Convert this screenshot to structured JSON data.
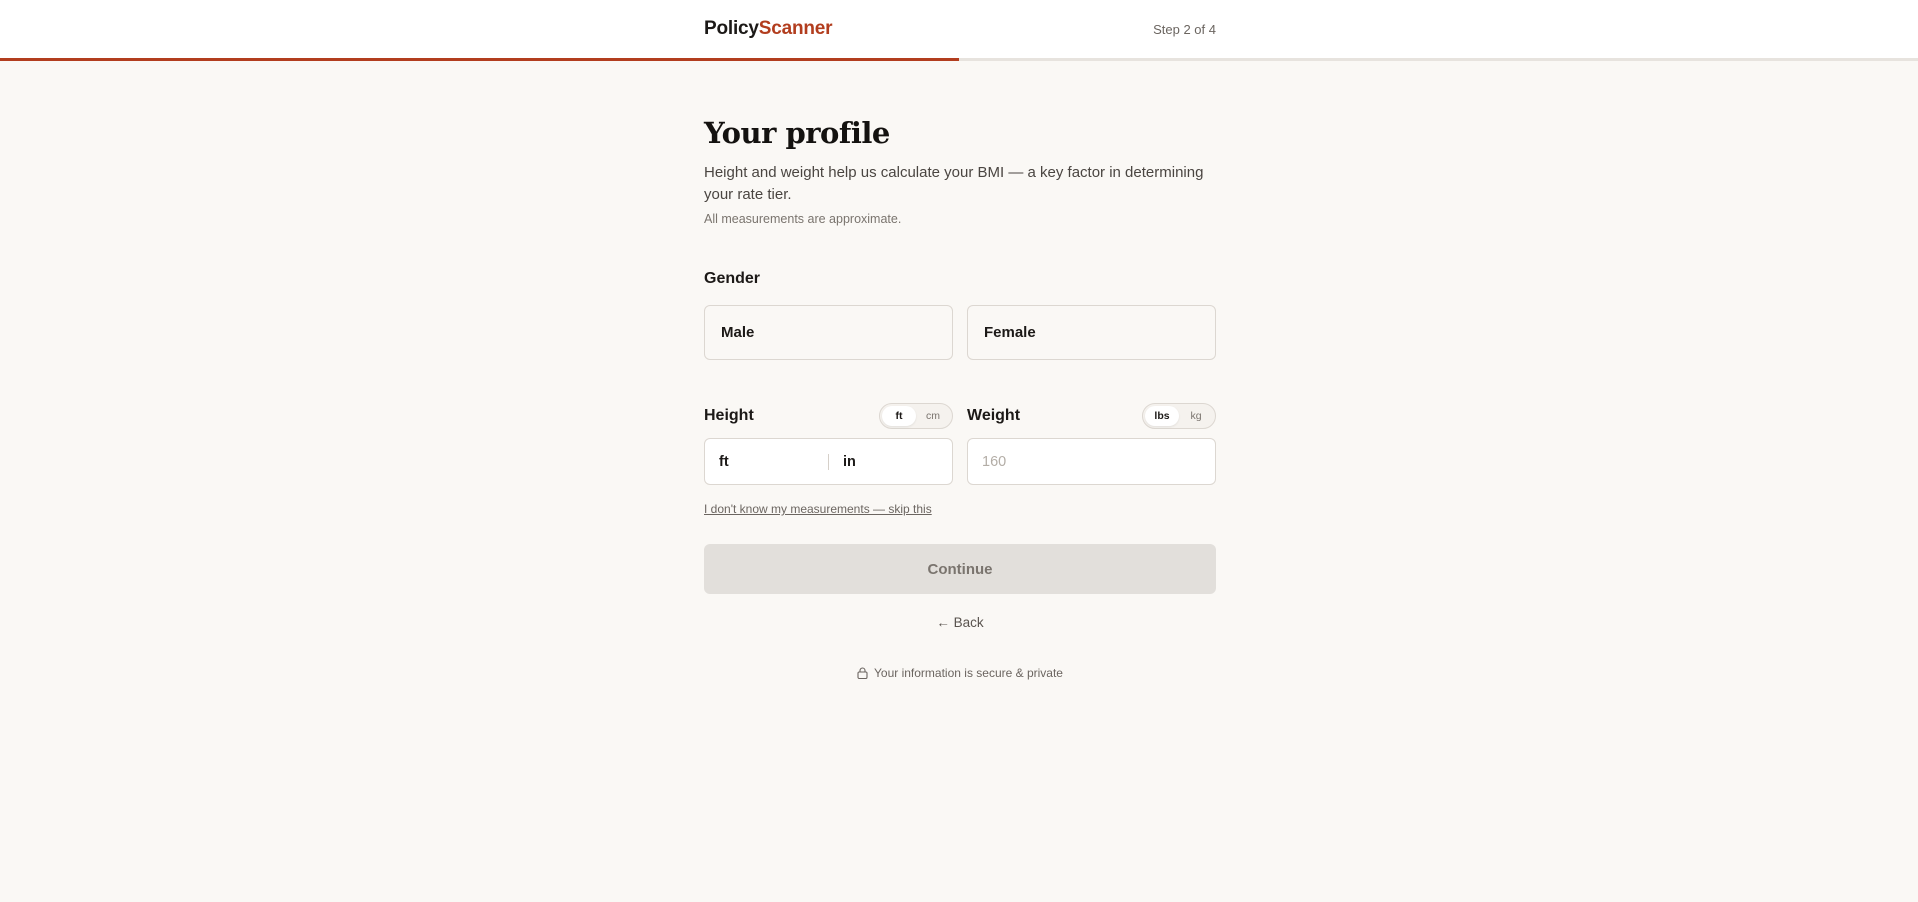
{
  "header": {
    "brand_a": "Policy",
    "brand_b": "Scanner",
    "step_text": "Step 2 of 4",
    "progress_fraction": 0.5,
    "accent_color": "#b23d1e"
  },
  "page": {
    "title": "Your profile",
    "subtitle": "Height and weight help us calculate your BMI — a key factor in determining your rate tier.",
    "note": "All measurements are approximate."
  },
  "gender": {
    "label": "Gender",
    "options": [
      "Male",
      "Female"
    ]
  },
  "height": {
    "label": "Height",
    "units": [
      "ft",
      "cm"
    ],
    "active_unit": "ft",
    "ft_label": "ft",
    "in_label": "in"
  },
  "weight": {
    "label": "Weight",
    "units": [
      "lbs",
      "kg"
    ],
    "active_unit": "lbs",
    "placeholder": "160",
    "value": ""
  },
  "actions": {
    "skip_text": "I don't know my measurements — skip this",
    "continue_label": "Continue",
    "back_label": "← Back"
  },
  "footer": {
    "secure_text": "Your information is secure & private",
    "icon": "lock-icon"
  }
}
